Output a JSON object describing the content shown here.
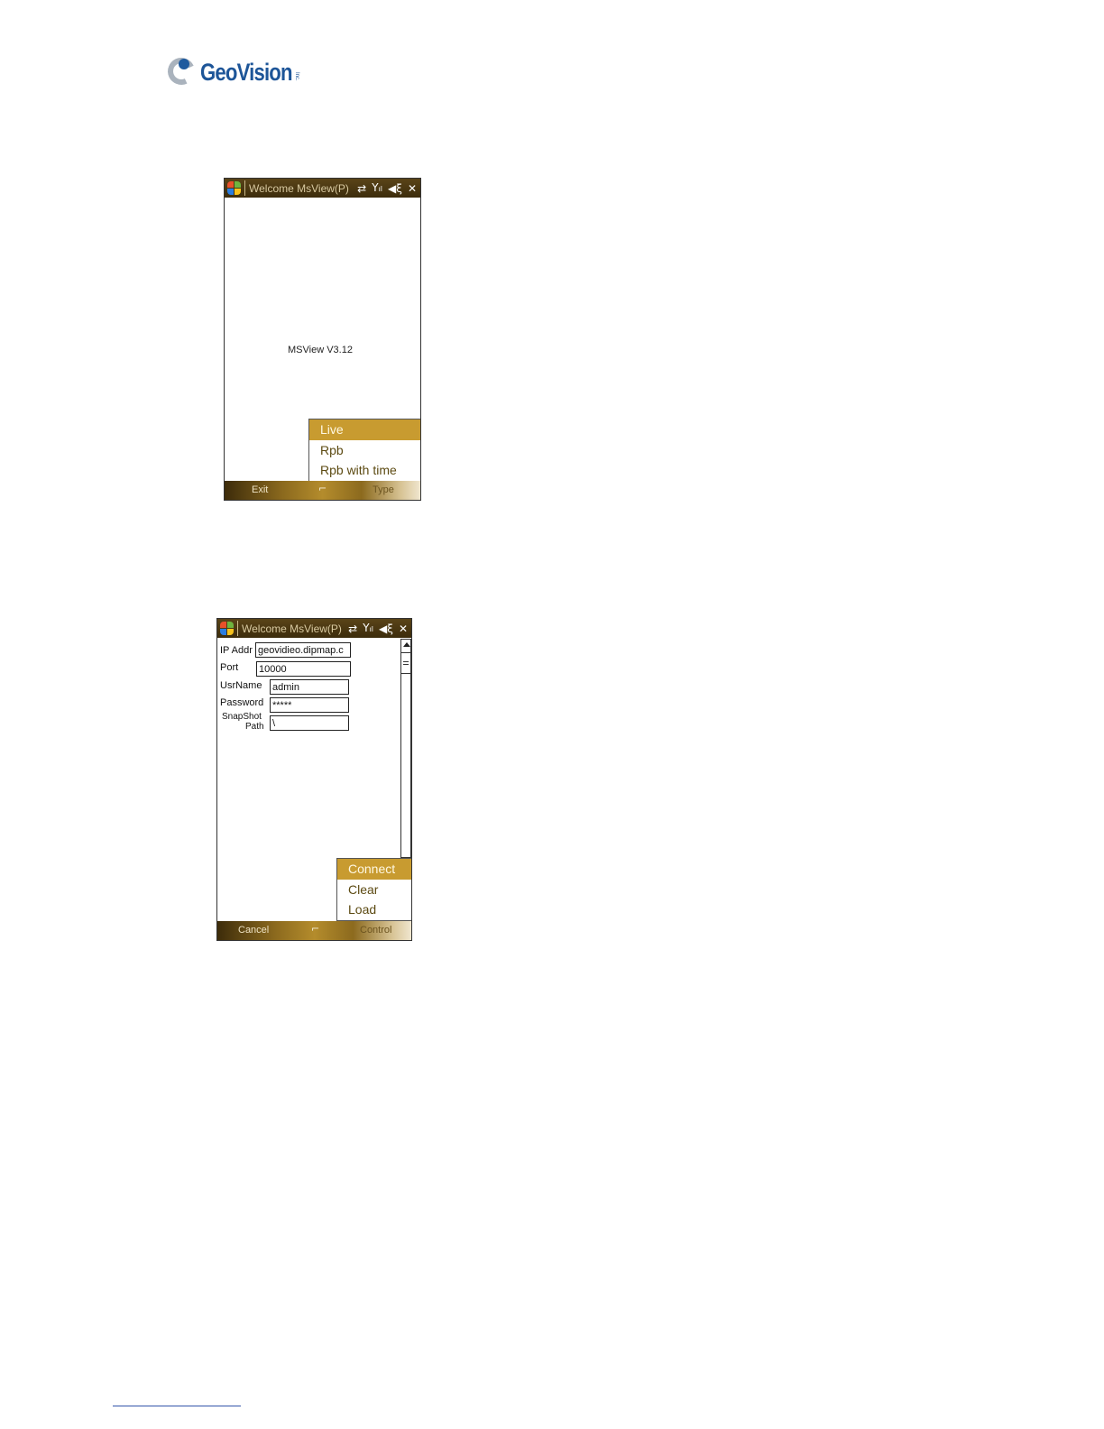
{
  "logo": {
    "text": "GeoVision",
    "suffix": "Inc."
  },
  "screen1": {
    "title": "Welcome MsView(P)",
    "version_text": "MSView V3.12",
    "menu": [
      {
        "label": "Live",
        "selected": true
      },
      {
        "label": "Rpb",
        "selected": false
      },
      {
        "label": "Rpb with time",
        "selected": false
      }
    ],
    "softkeys": {
      "left": "Exit",
      "right": "Type"
    },
    "status_icons": [
      "connectivity-icon",
      "signal-icon",
      "speaker-mute-icon",
      "close-icon"
    ]
  },
  "screen2": {
    "title": "Welcome MsView(P)",
    "fields": {
      "ip_label": "IP Addr",
      "ip_value": "geovidieo.dipmap.c",
      "port_label": "Port",
      "port_value": "10000",
      "user_label": "UsrName",
      "user_value": "admin",
      "password_label": "Password",
      "password_value": "*****",
      "snapshot_label_1": "SnapShot",
      "snapshot_label_2": "Path",
      "snapshot_value": "\\"
    },
    "menu": [
      {
        "label": "Connect",
        "selected": true
      },
      {
        "label": "Clear",
        "selected": false
      },
      {
        "label": "Load",
        "selected": false
      }
    ],
    "softkeys": {
      "left": "Cancel",
      "right": "Control"
    }
  },
  "colors": {
    "titlebar": "#4a3812",
    "menu_highlight": "#c89b30",
    "menu_text": "#5c4a12",
    "logo_blue": "#1d5598"
  }
}
